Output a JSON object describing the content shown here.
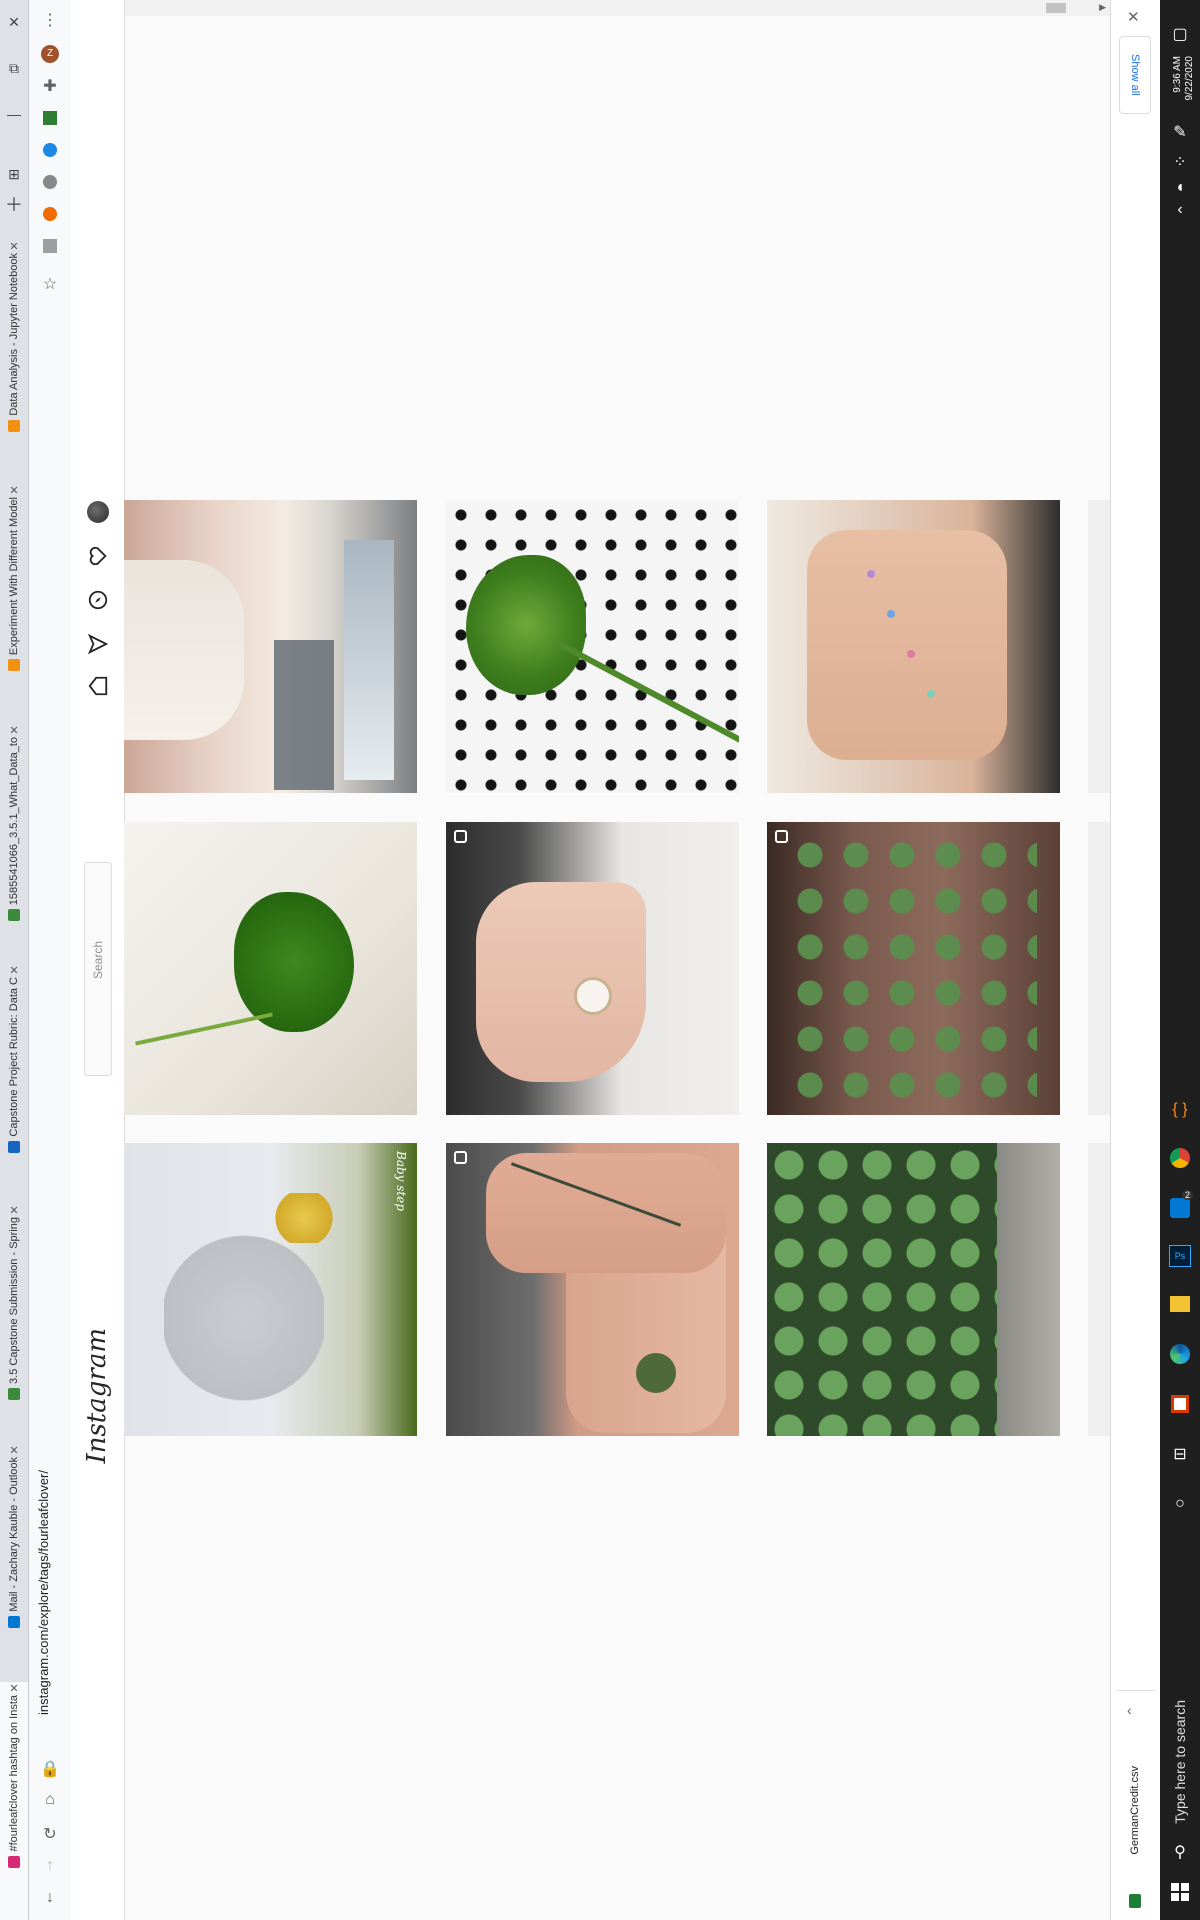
{
  "browser": {
    "tabs": [
      {
        "label": "#fourleafclover hashtag on Insta",
        "favicon_color": "#d62976",
        "active": true
      },
      {
        "label": "Mail - Zachary Kauble - Outlook",
        "favicon_color": "#0078d4",
        "active": false
      },
      {
        "label": "3.5 Capstone Submission - Spring",
        "favicon_color": "#3c8b3c",
        "active": false
      },
      {
        "label": "Capstone Project Rubric: Data C",
        "favicon_color": "#1565c0",
        "active": false
      },
      {
        "label": "1585541066_3.5.1_What_Data_to",
        "favicon_color": "#3c8b3c",
        "active": false
      },
      {
        "label": "Experiment With Different Model",
        "favicon_color": "#f29111",
        "active": false
      },
      {
        "label": "Data Analysis - Jupyter Notebook",
        "favicon_color": "#f29111",
        "active": false
      }
    ],
    "url": "instagram.com/explore/tags/fourleafclover/",
    "scroll_position": "9:36 AM"
  },
  "instagram": {
    "logo": "Instagram",
    "search_placeholder": "Search",
    "posts": [
      {
        "name": "post-selfie"
      },
      {
        "name": "post-clover-polka-dots"
      },
      {
        "name": "post-hand-clover-studs"
      },
      {
        "name": "post-clover-white"
      },
      {
        "name": "post-clover-ring",
        "multi": true
      },
      {
        "name": "post-clover-plant-pot",
        "multi": true
      },
      {
        "name": "post-sunflower-overlay",
        "watermark": "Baby step"
      },
      {
        "name": "post-tattoo-forearm",
        "multi": true
      },
      {
        "name": "post-clover-patch"
      }
    ]
  },
  "downloads": {
    "show_all": "Show all",
    "file": "GermanCredit.csv"
  },
  "taskbar": {
    "time": "9:36 AM",
    "date": "9/22/2020",
    "search_placeholder": "Type here to search",
    "outlook_badge": "2"
  }
}
